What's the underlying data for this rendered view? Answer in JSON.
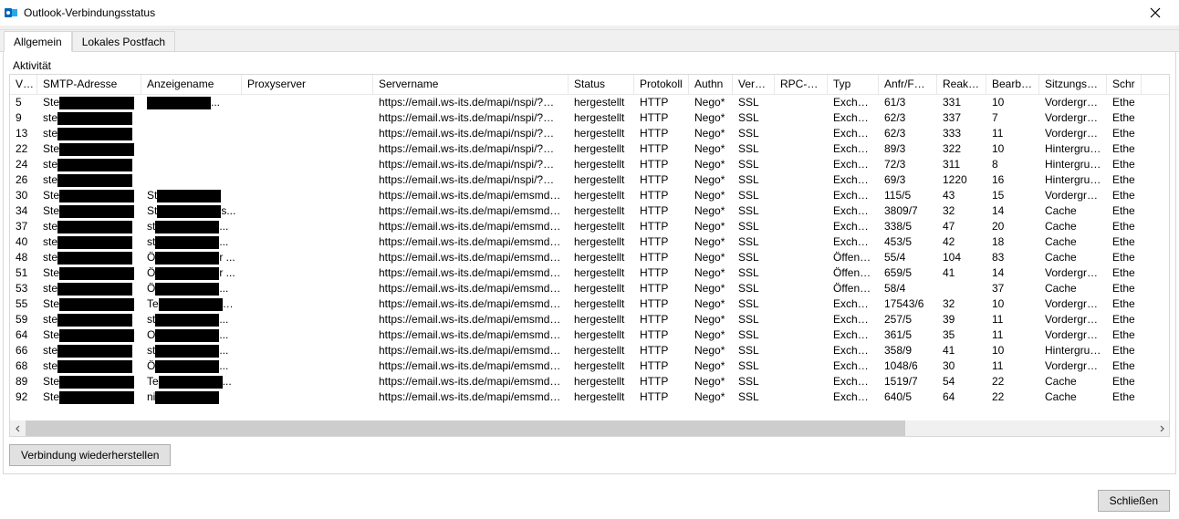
{
  "window": {
    "title": "Outlook-Verbindungsstatus"
  },
  "tabs": {
    "general": "Allgemein",
    "local_mailbox": "Lokales Postfach"
  },
  "group": {
    "label": "Aktivität"
  },
  "columns": {
    "vid": "VID",
    "smtp": "SMTP-Adresse",
    "anzeigename": "Anzeigename",
    "proxy": "Proxyserver",
    "server": "Servername",
    "status": "Status",
    "protokoll": "Protokoll",
    "authn": "Authn",
    "verschl": "Versc...",
    "rpcport": "RPC-Port",
    "typ": "Typ",
    "anf": "Anfr/Fehler",
    "reaktion": "Reaktion...",
    "bearb": "Bearb (Ø)",
    "sitzung": "Sitzungstyp",
    "schnitt": "Schr"
  },
  "buttons": {
    "reconnect": "Verbindung wiederherstellen",
    "close": "Schließen"
  },
  "rows": [
    {
      "vid": "5",
      "smtp": "Ste",
      "anz": "",
      "anz_suffix": "...",
      "proxy": "",
      "server": "https://email.ws-its.de/mapi/nspi/?Mailbo...",
      "status": "hergestellt",
      "prot": "HTTP",
      "auth": "Nego*",
      "vers": "SSL",
      "rpc": "",
      "typ": "Exchang...",
      "anf": "61/3",
      "reak": "331",
      "bearb": "10",
      "sitz": "Vordergrund",
      "schn": "Ethe"
    },
    {
      "vid": "9",
      "smtp": "ste",
      "anz": "",
      "anz_suffix": "",
      "proxy": "",
      "server": "https://email.ws-its.de/mapi/nspi/?Mailbo...",
      "status": "hergestellt",
      "prot": "HTTP",
      "auth": "Nego*",
      "vers": "SSL",
      "rpc": "",
      "typ": "Exchang...",
      "anf": "62/3",
      "reak": "337",
      "bearb": "7",
      "sitz": "Vordergrund",
      "schn": "Ethe"
    },
    {
      "vid": "13",
      "smtp": "ste",
      "anz": "",
      "anz_suffix": "",
      "proxy": "",
      "server": "https://email.ws-its.de/mapi/nspi/?Mailbo...",
      "status": "hergestellt",
      "prot": "HTTP",
      "auth": "Nego*",
      "vers": "SSL",
      "rpc": "",
      "typ": "Exchang...",
      "anf": "62/3",
      "reak": "333",
      "bearb": "11",
      "sitz": "Vordergrund",
      "schn": "Ethe"
    },
    {
      "vid": "22",
      "smtp": "Ste",
      "anz": "",
      "anz_suffix": "",
      "proxy": "",
      "server": "https://email.ws-its.de/mapi/nspi/?Mailbo...",
      "status": "hergestellt",
      "prot": "HTTP",
      "auth": "Nego*",
      "vers": "SSL",
      "rpc": "",
      "typ": "Exchang...",
      "anf": "89/3",
      "reak": "322",
      "bearb": "10",
      "sitz": "Hintergrund",
      "schn": "Ethe"
    },
    {
      "vid": "24",
      "smtp": "ste",
      "anz": "",
      "anz_suffix": "",
      "proxy": "",
      "server": "https://email.ws-its.de/mapi/nspi/?Mailbo...",
      "status": "hergestellt",
      "prot": "HTTP",
      "auth": "Nego*",
      "vers": "SSL",
      "rpc": "",
      "typ": "Exchang...",
      "anf": "72/3",
      "reak": "311",
      "bearb": "8",
      "sitz": "Hintergrund",
      "schn": "Ethe"
    },
    {
      "vid": "26",
      "smtp": "ste",
      "anz": "",
      "anz_suffix": "",
      "proxy": "",
      "server": "https://email.ws-its.de/mapi/nspi/?Mailbo...",
      "status": "hergestellt",
      "prot": "HTTP",
      "auth": "Nego*",
      "vers": "SSL",
      "rpc": "",
      "typ": "Exchang...",
      "anf": "69/3",
      "reak": "1220",
      "bearb": "16",
      "sitz": "Hintergrund",
      "schn": "Ethe"
    },
    {
      "vid": "30",
      "smtp": "Ste",
      "anz": "St",
      "anz_suffix": "",
      "proxy": "",
      "server": "https://email.ws-its.de/mapi/emsmdb/?M...",
      "status": "hergestellt",
      "prot": "HTTP",
      "auth": "Nego*",
      "vers": "SSL",
      "rpc": "",
      "typ": "Exchang...",
      "anf": "115/5",
      "reak": "43",
      "bearb": "15",
      "sitz": "Vordergrund",
      "schn": "Ethe"
    },
    {
      "vid": "34",
      "smtp": "Ste",
      "anz": "St",
      "anz_suffix": "s...",
      "proxy": "",
      "server": "https://email.ws-its.de/mapi/emsmdb/?M...",
      "status": "hergestellt",
      "prot": "HTTP",
      "auth": "Nego*",
      "vers": "SSL",
      "rpc": "",
      "typ": "Exchang...",
      "anf": "3809/7",
      "reak": "32",
      "bearb": "14",
      "sitz": "Cache",
      "schn": "Ethe"
    },
    {
      "vid": "37",
      "smtp": "ste",
      "anz": "st",
      "anz_suffix": "...",
      "proxy": "",
      "server": "https://email.ws-its.de/mapi/emsmdb/?M...",
      "status": "hergestellt",
      "prot": "HTTP",
      "auth": "Nego*",
      "vers": "SSL",
      "rpc": "",
      "typ": "Exchang...",
      "anf": "338/5",
      "reak": "47",
      "bearb": "20",
      "sitz": "Cache",
      "schn": "Ethe"
    },
    {
      "vid": "40",
      "smtp": "ste",
      "anz": "st",
      "anz_suffix": "...",
      "proxy": "",
      "server": "https://email.ws-its.de/mapi/emsmdb/?M...",
      "status": "hergestellt",
      "prot": "HTTP",
      "auth": "Nego*",
      "vers": "SSL",
      "rpc": "",
      "typ": "Exchang...",
      "anf": "453/5",
      "reak": "42",
      "bearb": "18",
      "sitz": "Cache",
      "schn": "Ethe"
    },
    {
      "vid": "48",
      "smtp": "ste",
      "anz": "Ö",
      "anz_suffix": "r ...",
      "proxy": "",
      "server": "https://email.ws-its.de/mapi/emsmdb/?M...",
      "status": "hergestellt",
      "prot": "HTTP",
      "auth": "Nego*",
      "vers": "SSL",
      "rpc": "",
      "typ": "Öffentlic...",
      "anf": "55/4",
      "reak": "104",
      "bearb": "83",
      "sitz": "Cache",
      "schn": "Ethe"
    },
    {
      "vid": "51",
      "smtp": "Ste",
      "anz": "Ö",
      "anz_suffix": "r ...",
      "proxy": "",
      "server": "https://email.ws-its.de/mapi/emsmdb/?M...",
      "status": "hergestellt",
      "prot": "HTTP",
      "auth": "Nego*",
      "vers": "SSL",
      "rpc": "",
      "typ": "Öffentlic...",
      "anf": "659/5",
      "reak": "41",
      "bearb": "14",
      "sitz": "Vordergrund",
      "schn": "Ethe"
    },
    {
      "vid": "53",
      "smtp": "ste",
      "anz": "Ö",
      "anz_suffix": "...",
      "proxy": "",
      "server": "https://email.ws-its.de/mapi/emsmdb/?M...",
      "status": "hergestellt",
      "prot": "HTTP",
      "auth": "Nego*",
      "vers": "SSL",
      "rpc": "",
      "typ": "Öffentlic...",
      "anf": "58/4",
      "reak": "",
      "bearb": "37",
      "sitz": "Cache",
      "schn": "Ethe"
    },
    {
      "vid": "55",
      "smtp": "Ste",
      "anz": "Te",
      "anz_suffix": "r ...",
      "proxy": "",
      "server": "https://email.ws-its.de/mapi/emsmdb/?M...",
      "status": "hergestellt",
      "prot": "HTTP",
      "auth": "Nego*",
      "vers": "SSL",
      "rpc": "",
      "typ": "Exchang...",
      "anf": "17543/6",
      "reak": "32",
      "bearb": "10",
      "sitz": "Vordergrund",
      "schn": "Ethe"
    },
    {
      "vid": "59",
      "smtp": "ste",
      "anz": "st",
      "anz_suffix": "...",
      "proxy": "",
      "server": "https://email.ws-its.de/mapi/emsmdb/?M...",
      "status": "hergestellt",
      "prot": "HTTP",
      "auth": "Nego*",
      "vers": "SSL",
      "rpc": "",
      "typ": "Exchang...",
      "anf": "257/5",
      "reak": "39",
      "bearb": "11",
      "sitz": "Vordergrund",
      "schn": "Ethe"
    },
    {
      "vid": "64",
      "smtp": "Ste",
      "anz": "O",
      "anz_suffix": "...",
      "proxy": "",
      "server": "https://email.ws-its.de/mapi/emsmdb/?M...",
      "status": "hergestellt",
      "prot": "HTTP",
      "auth": "Nego*",
      "vers": "SSL",
      "rpc": "",
      "typ": "Exchang...",
      "anf": "361/5",
      "reak": "35",
      "bearb": "11",
      "sitz": "Vordergrund",
      "schn": "Ethe"
    },
    {
      "vid": "66",
      "smtp": "ste",
      "anz": "st",
      "anz_suffix": "...",
      "proxy": "",
      "server": "https://email.ws-its.de/mapi/emsmdb/?M...",
      "status": "hergestellt",
      "prot": "HTTP",
      "auth": "Nego*",
      "vers": "SSL",
      "rpc": "",
      "typ": "Exchang...",
      "anf": "358/9",
      "reak": "41",
      "bearb": "10",
      "sitz": "Hintergrund",
      "schn": "Ethe"
    },
    {
      "vid": "68",
      "smtp": "ste",
      "anz": "Ö",
      "anz_suffix": "...",
      "proxy": "",
      "server": "https://email.ws-its.de/mapi/emsmdb/?M...",
      "status": "hergestellt",
      "prot": "HTTP",
      "auth": "Nego*",
      "vers": "SSL",
      "rpc": "",
      "typ": "Exchang...",
      "anf": "1048/6",
      "reak": "30",
      "bearb": "11",
      "sitz": "Vordergrund",
      "schn": "Ethe"
    },
    {
      "vid": "89",
      "smtp": "Ste",
      "anz": "Te",
      "anz_suffix": "...",
      "proxy": "",
      "server": "https://email.ws-its.de/mapi/emsmdb/?M...",
      "status": "hergestellt",
      "prot": "HTTP",
      "auth": "Nego*",
      "vers": "SSL",
      "rpc": "",
      "typ": "Exchang...",
      "anf": "1519/7",
      "reak": "54",
      "bearb": "22",
      "sitz": "Cache",
      "schn": "Ethe"
    },
    {
      "vid": "92",
      "smtp": "Ste",
      "anz": "ni",
      "anz_suffix": "",
      "proxy": "",
      "server": "https://email.ws-its.de/mapi/emsmdb/?M...",
      "status": "hergestellt",
      "prot": "HTTP",
      "auth": "Nego*",
      "vers": "SSL",
      "rpc": "",
      "typ": "Exchang...",
      "anf": "640/5",
      "reak": "64",
      "bearb": "22",
      "sitz": "Cache",
      "schn": "Ethe"
    }
  ]
}
